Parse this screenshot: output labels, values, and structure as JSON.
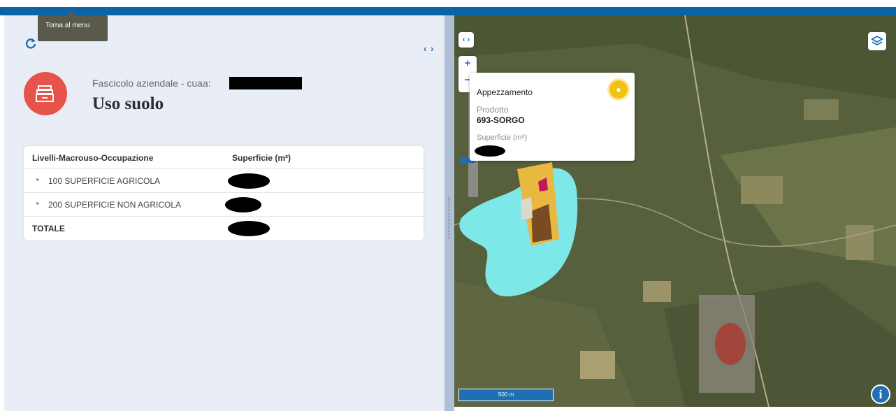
{
  "tooltip": {
    "text": "Torna al menu"
  },
  "header": {
    "subtitle": "Fascicolo aziendale - cuaa:",
    "title": "Uso suolo"
  },
  "icons": {
    "refresh": "refresh-icon",
    "collapse": "collapse-panel-icon",
    "badge": "folder-stack-icon",
    "layers": "layers-icon",
    "info": "info-icon",
    "pin": "location-pin-icon"
  },
  "colors": {
    "accent": "#1f6fb5",
    "topbar": "#0b63a8",
    "badge": "#e5534b",
    "pin": "#f3c110"
  },
  "table": {
    "columns": [
      "Livelli-Macrouso-Occupazione",
      "Superficie (m²)"
    ],
    "rows": [
      {
        "label": "100 SUPERFICIE AGRICOLA"
      },
      {
        "label": "200 SUPERFICIE NON AGRICOLA"
      }
    ],
    "total_label": "TOTALE"
  },
  "map": {
    "popup": {
      "title": "Appezzamento",
      "product_label": "Prodotto",
      "product_value": "693-SORGO",
      "surface_label": "Superficie (m²)"
    },
    "zoom_in": "+",
    "zoom_out": "−",
    "expand": "‹ ›",
    "scale": "500 m",
    "info": "i"
  }
}
